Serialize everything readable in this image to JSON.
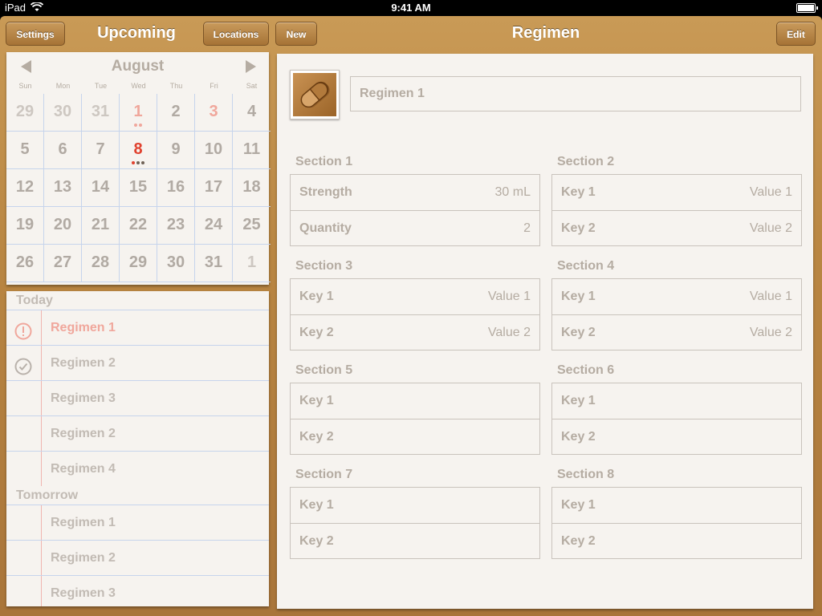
{
  "status_bar": {
    "device": "iPad",
    "time": "9:41 AM"
  },
  "left_nav": {
    "settings_label": "Settings",
    "title": "Upcoming",
    "locations_label": "Locations"
  },
  "right_nav": {
    "new_label": "New",
    "title": "Regimen",
    "edit_label": "Edit"
  },
  "calendar": {
    "month": "August",
    "weekdays": [
      "Sun",
      "Mon",
      "Tue",
      "Wed",
      "Thu",
      "Fri",
      "Sat"
    ],
    "weeks": [
      [
        "29",
        "30",
        "31",
        "1",
        "2",
        "3",
        "4"
      ],
      [
        "5",
        "6",
        "7",
        "8",
        "9",
        "10",
        "11"
      ],
      [
        "12",
        "13",
        "14",
        "15",
        "16",
        "17",
        "18"
      ],
      [
        "19",
        "20",
        "21",
        "22",
        "23",
        "24",
        "25"
      ],
      [
        "26",
        "27",
        "28",
        "29",
        "30",
        "31",
        "1"
      ]
    ],
    "selected_day": "8"
  },
  "list": {
    "today_header": "Today",
    "today_items": [
      "Regimen 1",
      "Regimen 2",
      "Regimen 3",
      "Regimen 2",
      "Regimen 4"
    ],
    "tomorrow_header": "Tomorrow",
    "tomorrow_items": [
      "Regimen 1",
      "Regimen 2",
      "Regimen 3"
    ]
  },
  "detail": {
    "name": "Regimen 1",
    "sections": [
      {
        "title": "Section 1",
        "rows": [
          {
            "key": "Strength",
            "value": "30 mL"
          },
          {
            "key": "Quantity",
            "value": "2"
          }
        ]
      },
      {
        "title": "Section 2",
        "rows": [
          {
            "key": "Key 1",
            "value": "Value 1"
          },
          {
            "key": "Key 2",
            "value": "Value 2"
          }
        ]
      },
      {
        "title": "Section 3",
        "rows": [
          {
            "key": "Key 1",
            "value": "Value 1"
          },
          {
            "key": "Key 2",
            "value": "Value 2"
          }
        ]
      },
      {
        "title": "Section 4",
        "rows": [
          {
            "key": "Key 1",
            "value": "Value 1"
          },
          {
            "key": "Key 2",
            "value": "Value 2"
          }
        ]
      },
      {
        "title": "Section 5",
        "rows": [
          {
            "key": "Key 1",
            "value": ""
          },
          {
            "key": "Key 2",
            "value": ""
          }
        ]
      },
      {
        "title": "Section 6",
        "rows": [
          {
            "key": "Key 1",
            "value": ""
          },
          {
            "key": "Key 2",
            "value": ""
          }
        ]
      },
      {
        "title": "Section 7",
        "rows": [
          {
            "key": "Key 1",
            "value": ""
          },
          {
            "key": "Key 2",
            "value": ""
          }
        ]
      },
      {
        "title": "Section 8",
        "rows": [
          {
            "key": "Key 1",
            "value": ""
          },
          {
            "key": "Key 2",
            "value": ""
          }
        ]
      }
    ]
  },
  "colors": {
    "accent_red": "#e0412e",
    "leather": "#b98642",
    "paper": "#f6f3ef",
    "rule_blue": "#c6d4ec"
  }
}
